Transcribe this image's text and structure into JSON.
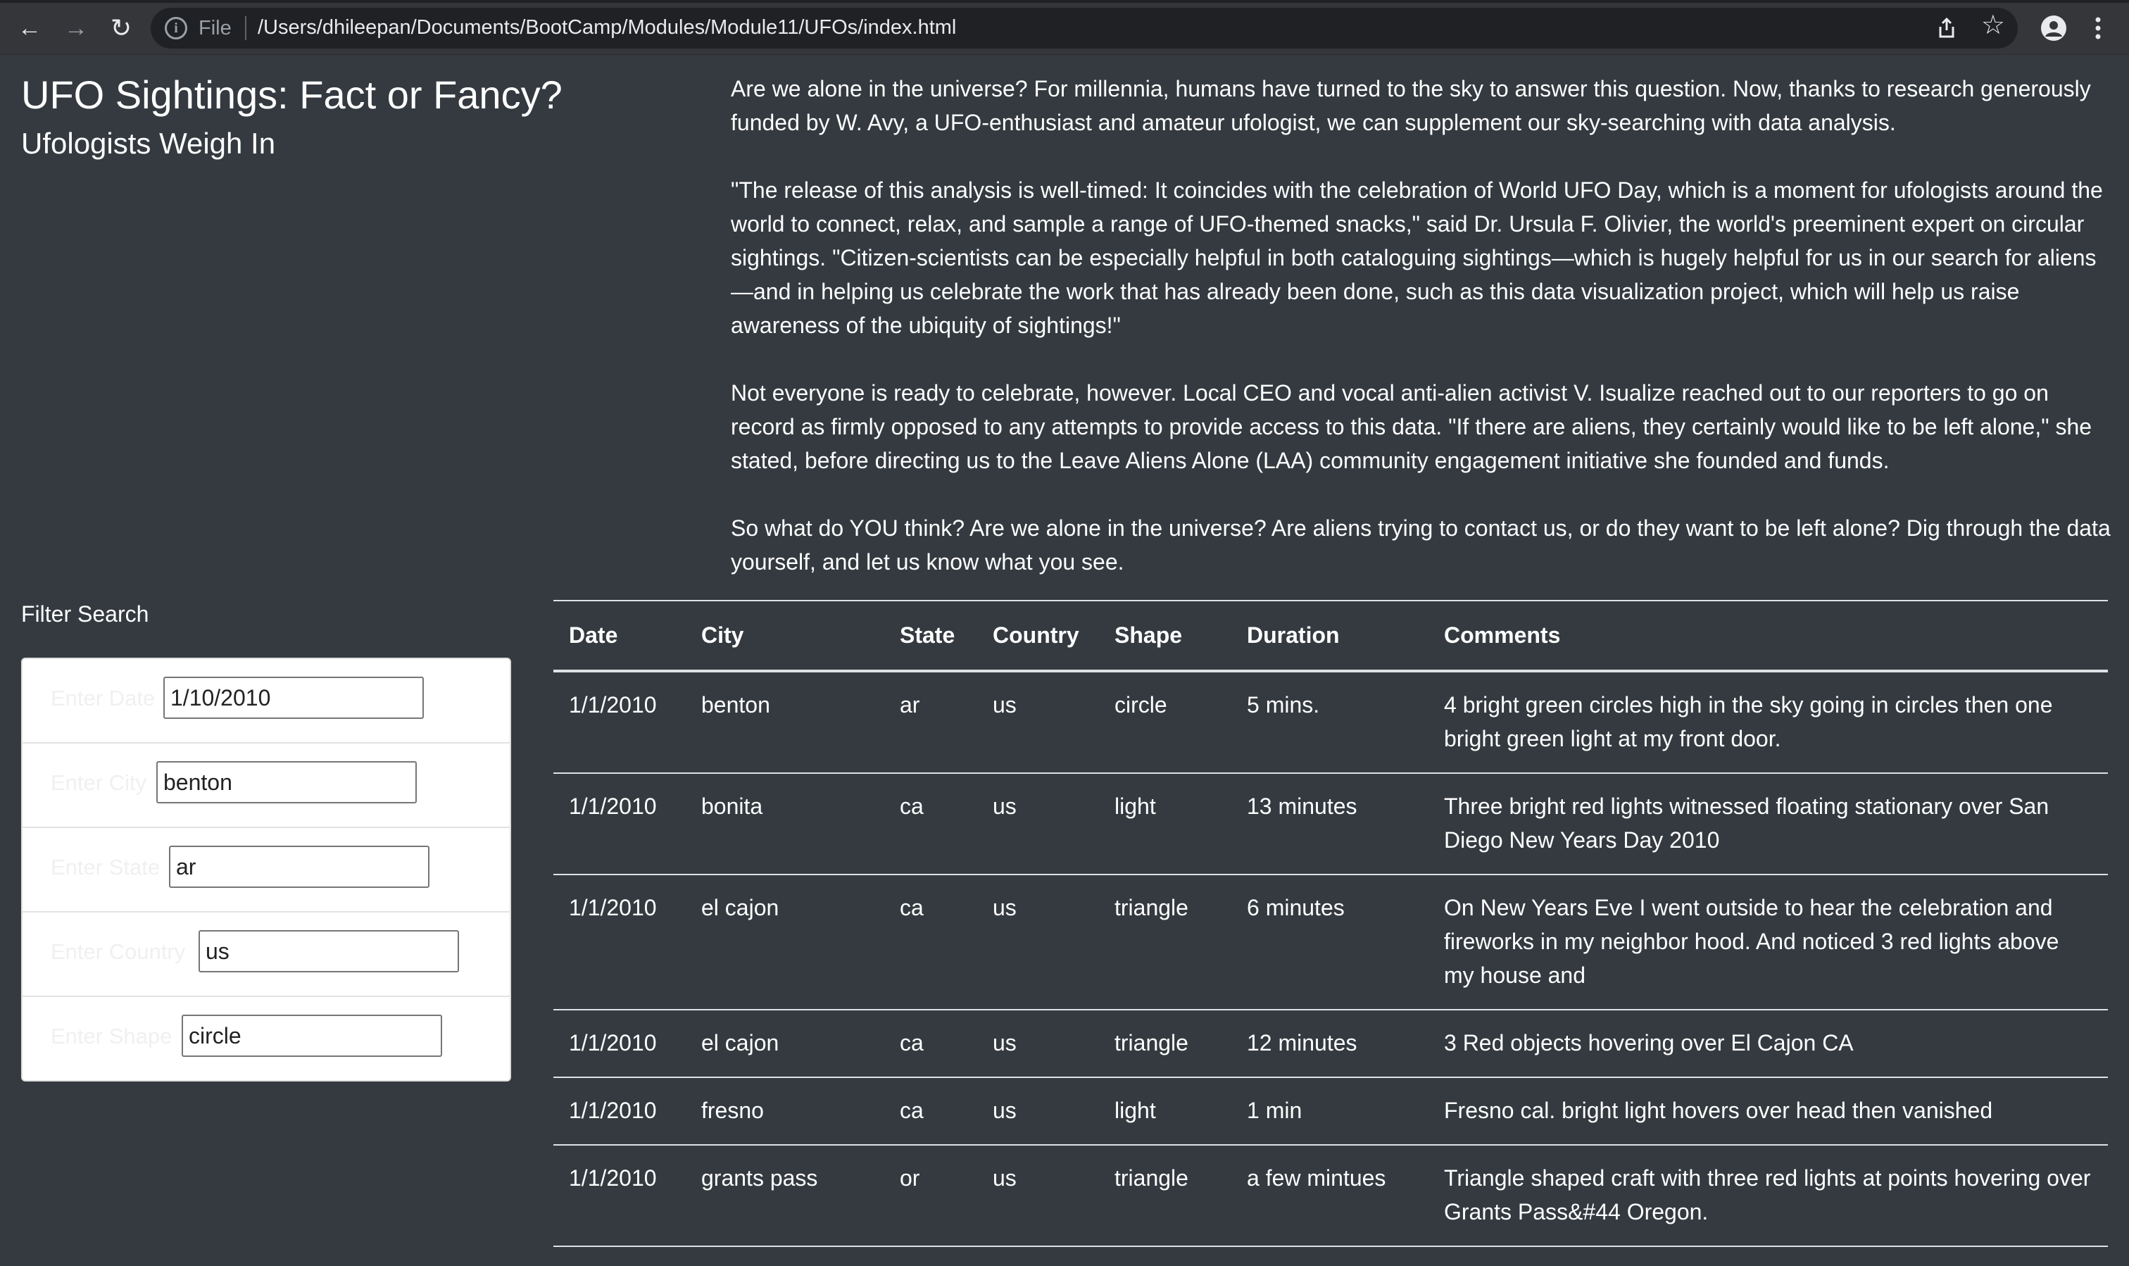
{
  "browser": {
    "file_label": "File",
    "url": "/Users/dhileepan/Documents/BootCamp/Modules/Module11/UFOs/index.html"
  },
  "header": {
    "title": "UFO Sightings: Fact or Fancy?",
    "subtitle": "Ufologists Weigh In"
  },
  "article": {
    "paragraphs": [
      "Are we alone in the universe? For millennia, humans have turned to the sky to answer this question. Now, thanks to research generously funded by W. Avy, a UFO-enthusiast and amateur ufologist, we can supplement our sky-searching with data analysis.",
      "\"The release of this analysis is well-timed: It coincides with the celebration of World UFO Day, which is a moment for ufologists around the world to connect, relax, and sample a range of UFO-themed snacks,\" said Dr. Ursula F. Olivier, the world's preeminent expert on circular sightings. \"Citizen-scientists can be especially helpful in both cataloguing sightings—which is hugely helpful for us in our search for aliens—and in helping us celebrate the work that has already been done, such as this data visualization project, which will help us raise awareness of the ubiquity of sightings!\"",
      "Not everyone is ready to celebrate, however. Local CEO and vocal anti-alien activist V. Isualize reached out to our reporters to go on record as firmly opposed to any attempts to provide access to this data. \"If there are aliens, they certainly would like to be left alone,\" she stated, before directing us to the Leave Aliens Alone (LAA) community engagement initiative she founded and funds.",
      "So what do YOU think? Are we alone in the universe? Are aliens trying to contact us, or do they want to be left alone? Dig through the data yourself, and let us know what you see."
    ]
  },
  "filter": {
    "heading": "Filter Search",
    "fields": [
      {
        "label": "Enter Date",
        "value": "1/10/2010"
      },
      {
        "label": "Enter City",
        "value": "benton"
      },
      {
        "label": "Enter State",
        "value": "ar"
      },
      {
        "label": "Enter Country",
        "value": "us"
      },
      {
        "label": "Enter Shape",
        "value": "circle"
      }
    ]
  },
  "table": {
    "headers": [
      "Date",
      "City",
      "State",
      "Country",
      "Shape",
      "Duration",
      "Comments"
    ],
    "rows": [
      [
        "1/1/2010",
        "benton",
        "ar",
        "us",
        "circle",
        "5 mins.",
        "4 bright green circles high in the sky going in circles then one bright green light at my front door."
      ],
      [
        "1/1/2010",
        "bonita",
        "ca",
        "us",
        "light",
        "13 minutes",
        "Three bright red lights witnessed floating stationary over San Diego New Years Day 2010"
      ],
      [
        "1/1/2010",
        "el cajon",
        "ca",
        "us",
        "triangle",
        "6 minutes",
        "On New Years Eve I went outside to hear the celebration and fireworks in my neighbor hood. And noticed 3 red lights above my house and"
      ],
      [
        "1/1/2010",
        "el cajon",
        "ca",
        "us",
        "triangle",
        "12 minutes",
        "3 Red objects hovering over El Cajon CA"
      ],
      [
        "1/1/2010",
        "fresno",
        "ca",
        "us",
        "light",
        "1 min",
        "Fresno cal. bright light hovers over head then vanished"
      ],
      [
        "1/1/2010",
        "grants pass",
        "or",
        "us",
        "triangle",
        "a few mintues",
        "Triangle shaped craft with three red lights at points hovering over Grants Pass&#44 Oregon."
      ]
    ]
  }
}
